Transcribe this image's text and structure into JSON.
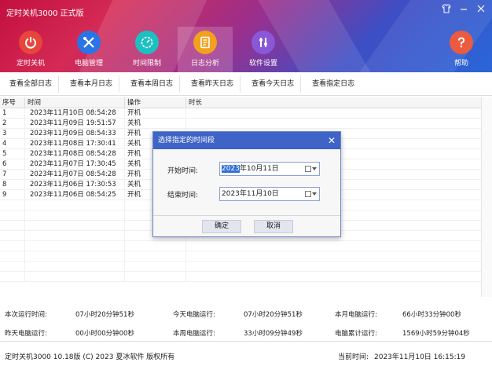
{
  "window": {
    "title": "定时关机3000 正式版",
    "controls": [
      "shirt-icon",
      "minimize-icon",
      "close-icon"
    ]
  },
  "nav": {
    "items": [
      {
        "label": "定时关机",
        "icon": "power-icon",
        "color": "#e8453c"
      },
      {
        "label": "电脑管理",
        "icon": "tools-icon",
        "color": "#2b74e6"
      },
      {
        "label": "时间限制",
        "icon": "clock-icon",
        "color": "#1cc0c0"
      },
      {
        "label": "日志分析",
        "icon": "log-icon",
        "color": "#f2a11f"
      },
      {
        "label": "软件设置",
        "icon": "settings-icon",
        "color": "#8a57d6"
      },
      {
        "label": "帮助",
        "icon": "help-icon",
        "color": "#ea5b40"
      }
    ],
    "active_index": 3
  },
  "toolbar": {
    "buttons": [
      "查看全部日志",
      "查看本月日志",
      "查看本周日志",
      "查看昨天日志",
      "查看今天日志",
      "查看指定日志"
    ]
  },
  "table": {
    "headers": [
      "序号",
      "时间",
      "操作",
      "时长"
    ],
    "rows": [
      {
        "no": "1",
        "time": "2023年11月10日 08:54:28",
        "op": "开机",
        "dur": ""
      },
      {
        "no": "2",
        "time": "2023年11月09日 19:51:57",
        "op": "关机",
        "dur": ""
      },
      {
        "no": "3",
        "time": "2023年11月09日 08:54:33",
        "op": "开机",
        "dur": ""
      },
      {
        "no": "4",
        "time": "2023年11月08日 17:30:41",
        "op": "关机",
        "dur": ""
      },
      {
        "no": "5",
        "time": "2023年11月08日 08:54:28",
        "op": "开机",
        "dur": ""
      },
      {
        "no": "6",
        "time": "2023年11月07日 17:30:45",
        "op": "关机",
        "dur": ""
      },
      {
        "no": "7",
        "time": "2023年11月07日 08:54:28",
        "op": "开机",
        "dur": ""
      },
      {
        "no": "8",
        "time": "2023年11月06日 17:30:53",
        "op": "关机",
        "dur": ""
      },
      {
        "no": "9",
        "time": "2023年11月06日 08:54:25",
        "op": "开机",
        "dur": ""
      }
    ]
  },
  "stats": {
    "this_run_label": "本次运行时间:",
    "this_run_value": "07小时20分钟51秒",
    "today_label": "今天电脑运行:",
    "today_value": "07小时20分钟51秒",
    "month_label": "本月电脑运行:",
    "month_value": "66小时33分钟00秒",
    "yesterday_label": "昨天电脑运行:",
    "yesterday_value": "00小时00分钟00秒",
    "week_label": "本周电脑运行:",
    "week_value": "33小时09分钟49秒",
    "total_label": "电脑累计运行:",
    "total_value": "1569小时59分钟04秒"
  },
  "statusbar": {
    "left": "定时关机3000 10.18版 (C) 2023  夏冰软件 版权所有",
    "right_label": "当前时间:",
    "right_value": "2023年11月10日 16:15:19"
  },
  "dialog": {
    "title": "选择指定的时间段",
    "start_label": "开始时间:",
    "start_year": "2023",
    "start_rest": "年10月11日",
    "end_label": "结束时间:",
    "end_value": "2023年11月10日",
    "ok_label": "确定",
    "cancel_label": "取消"
  }
}
